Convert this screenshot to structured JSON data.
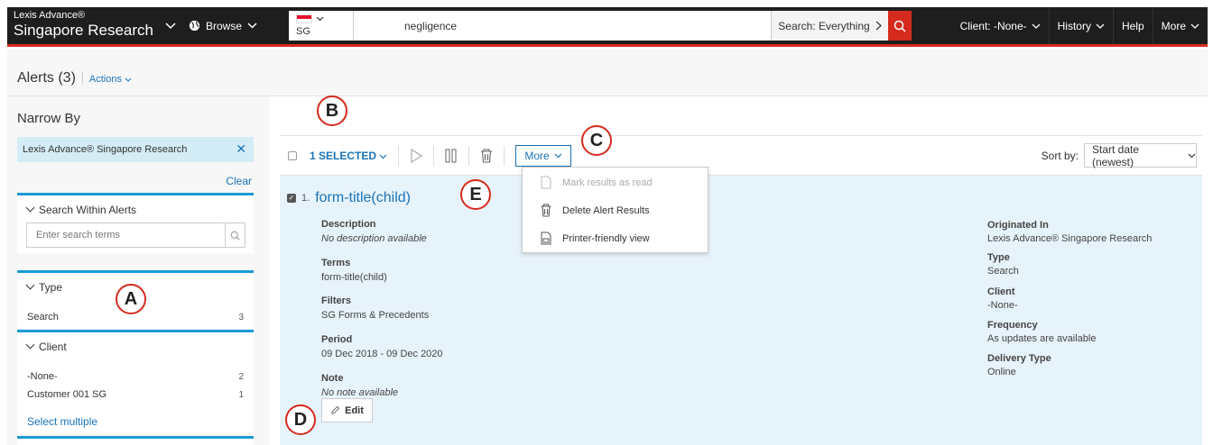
{
  "topnav": {
    "brand_small": "Lexis Advance®",
    "brand_big": "Singapore Research",
    "browse": "Browse",
    "jurisdiction": "SG",
    "query": "negligence",
    "scope": "Search: Everything",
    "client": "Client: -None-",
    "history": "History",
    "help": "Help",
    "more": "More"
  },
  "subhead": {
    "title": "Alerts (3)",
    "actions": "Actions"
  },
  "sidebar": {
    "narrow_by": "Narrow By",
    "chip": "Lexis Advance® Singapore Research",
    "clear": "Clear",
    "search_within": {
      "title": "Search Within Alerts",
      "placeholder": "Enter search terms"
    },
    "type": {
      "title": "Type",
      "items": [
        {
          "label": "Search",
          "count": "3"
        }
      ]
    },
    "client": {
      "title": "Client",
      "items": [
        {
          "label": "-None-",
          "count": "2"
        },
        {
          "label": "Customer 001 SG",
          "count": "1"
        }
      ],
      "select_multiple": "Select multiple"
    }
  },
  "toolbar": {
    "selected": "1 SELECTED",
    "more": "More",
    "sort_label": "Sort by:",
    "sort_value": "Start date (newest)"
  },
  "dropdown": {
    "items": [
      {
        "label": "Mark results as read",
        "disabled": true
      },
      {
        "label": "Delete Alert Results",
        "disabled": false
      },
      {
        "label": "Printer-friendly view",
        "disabled": false
      }
    ]
  },
  "result": {
    "number": "1.",
    "title": "form-title(child)",
    "fields_left": [
      {
        "label": "Description",
        "value": "No description available"
      },
      {
        "label": "Terms",
        "value": "form-title(child)"
      },
      {
        "label": "Filters",
        "value": "SG Forms & Precedents"
      },
      {
        "label": "Period",
        "value": "09 Dec 2018 - 09 Dec 2020"
      },
      {
        "label": "Note",
        "value": "No note available"
      }
    ],
    "fields_right": [
      {
        "label": "Originated In",
        "value": "Lexis Advance® Singapore Research"
      },
      {
        "label": "Type",
        "value": "Search"
      },
      {
        "label": "Client",
        "value": "-None-"
      },
      {
        "label": "Frequency",
        "value": "As updates are available"
      },
      {
        "label": "Delivery Type",
        "value": "Online"
      }
    ],
    "edit": "Edit"
  },
  "callouts": {
    "a": "A",
    "b": "B",
    "c": "C",
    "d": "D",
    "e": "E"
  },
  "colors": {
    "accent": "#1a73b8",
    "brand_red": "#d52b1e",
    "panel_blue": "#1a9ad6",
    "result_bg": "#e7f3fa"
  }
}
